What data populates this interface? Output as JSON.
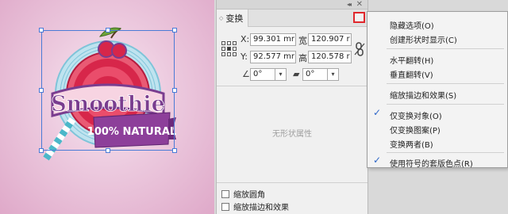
{
  "artwork": {
    "title_text": "Smoothie",
    "banner_text": "100% NATURAL",
    "colors": {
      "pink_bg": "#ecc9de",
      "red_main": "#d7264a",
      "purple": "#7a3d8f",
      "teal": "#4bb7c9",
      "ring_blue": "#9ed3e4"
    }
  },
  "panel": {
    "tab_label": "变换",
    "collapse_glyph": "◂◂",
    "close_glyph": "✕",
    "x_label": "X:",
    "x_value": "99.301 mr",
    "width_label": "宽：",
    "width_value": "120.907 r",
    "y_label": "Y:",
    "y_value": "92.577 mr",
    "height_label": "高：",
    "height_value": "120.578 r",
    "rotate_value": "0°",
    "shear_value": "0°",
    "no_shape_text": "无形状属性",
    "scale_corners_label": "缩放圆角",
    "scale_strokes_label": "缩放描边和效果"
  },
  "menu": {
    "items": [
      {
        "label": "隐藏选项(O)",
        "checked": false
      },
      {
        "label": "创建形状时显示(C)",
        "checked": false
      },
      {
        "label": "水平翻转(H)",
        "checked": false
      },
      {
        "label": "垂直翻转(V)",
        "checked": false
      },
      {
        "label": "缩放描边和效果(S)",
        "checked": false
      },
      {
        "label": "仅变换对象(O)",
        "checked": true
      },
      {
        "label": "仅变换图案(P)",
        "checked": false
      },
      {
        "label": "变换两者(B)",
        "checked": false
      },
      {
        "label": "使用符号的套版色点(R)",
        "checked": true
      }
    ],
    "check_glyph": "✓"
  }
}
